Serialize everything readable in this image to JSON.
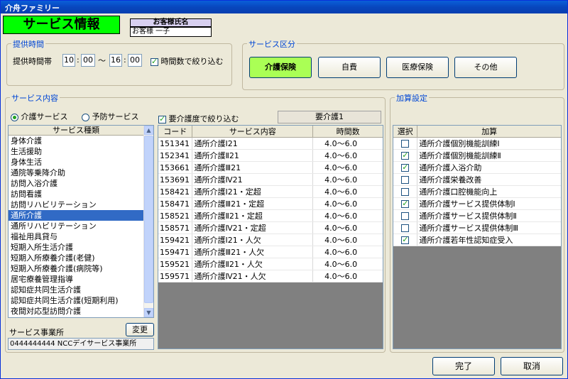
{
  "window": {
    "title": "介舟ファミリー"
  },
  "header": {
    "title": "サービス情報",
    "customer_label": "お客様氏名",
    "customer_name": "お客様 一子"
  },
  "time": {
    "group_title": "提供時間",
    "label": "提供時間帯",
    "start_h": "10",
    "start_m": "00",
    "tilde": "～",
    "end_h": "16",
    "end_m": "00",
    "colon": ":",
    "filter_label": "時間数で絞り込む",
    "filter_checked": true
  },
  "category": {
    "group_title": "サービス区分",
    "buttons": [
      "介護保険",
      "自費",
      "医療保険",
      "その他"
    ],
    "selected": 0
  },
  "service": {
    "group_title": "サービス内容",
    "radio_care": "介護サービス",
    "radio_prevent": "予防サービス",
    "filter_label": "要介護度で絞り込む",
    "care_level": "要介護1",
    "type_header": "サービス種類",
    "types": [
      "身体介護",
      "生活援助",
      "身体生活",
      "通院等乗降介助",
      "訪問入浴介護",
      "訪問看護",
      "訪問リハビリテーション",
      "通所介護",
      "通所リハビリテーション",
      "福祉用具貸与",
      "短期入所生活介護",
      "短期入所療養介護(老健)",
      "短期入所療養介護(病院等)",
      "居宅療養管理指導",
      "認知症共同生活介護",
      "認知症共同生活介護(短期利用)",
      "夜間対応型訪問介護"
    ],
    "selected_type": 7,
    "grid_headers": [
      "コード",
      "サービス内容",
      "時間数"
    ],
    "rows": [
      {
        "code": "151341",
        "name": "通所介護Ⅰ21",
        "hours": "4.0～6.0"
      },
      {
        "code": "152341",
        "name": "通所介護Ⅱ21",
        "hours": "4.0～6.0"
      },
      {
        "code": "153661",
        "name": "通所介護Ⅲ21",
        "hours": "4.0～6.0"
      },
      {
        "code": "153691",
        "name": "通所介護Ⅳ21",
        "hours": "4.0～6.0"
      },
      {
        "code": "158421",
        "name": "通所介護Ⅰ21・定超",
        "hours": "4.0～6.0"
      },
      {
        "code": "158471",
        "name": "通所介護Ⅲ21・定超",
        "hours": "4.0～6.0"
      },
      {
        "code": "158521",
        "name": "通所介護Ⅱ21・定超",
        "hours": "4.0～6.0"
      },
      {
        "code": "158571",
        "name": "通所介護Ⅳ21・定超",
        "hours": "4.0～6.0"
      },
      {
        "code": "159421",
        "name": "通所介護Ⅰ21・人欠",
        "hours": "4.0～6.0"
      },
      {
        "code": "159471",
        "name": "通所介護Ⅲ21・人欠",
        "hours": "4.0～6.0"
      },
      {
        "code": "159521",
        "name": "通所介護Ⅱ21・人欠",
        "hours": "4.0～6.0"
      },
      {
        "code": "159571",
        "name": "通所介護Ⅳ21・人欠",
        "hours": "4.0～6.0"
      }
    ],
    "office_label": "サービス事業所",
    "change_button": "変更",
    "office_value": "0444444444 NCCデイサービス事業所"
  },
  "addon": {
    "group_title": "加算設定",
    "headers": [
      "選択",
      "加算"
    ],
    "rows": [
      {
        "name": "通所介護個別機能訓練Ⅰ",
        "checked": false
      },
      {
        "name": "通所介護個別機能訓練Ⅱ",
        "checked": true
      },
      {
        "name": "通所介護入浴介助",
        "checked": true
      },
      {
        "name": "通所介護栄養改善",
        "checked": false
      },
      {
        "name": "通所介護口腔機能向上",
        "checked": false
      },
      {
        "name": "通所介護サービス提供体制Ⅰ",
        "checked": true
      },
      {
        "name": "通所介護サービス提供体制Ⅱ",
        "checked": false
      },
      {
        "name": "通所介護サービス提供体制Ⅲ",
        "checked": false
      },
      {
        "name": "通所介護若年性認知症受入",
        "checked": true
      }
    ]
  },
  "footer": {
    "ok": "完了",
    "cancel": "取消"
  }
}
